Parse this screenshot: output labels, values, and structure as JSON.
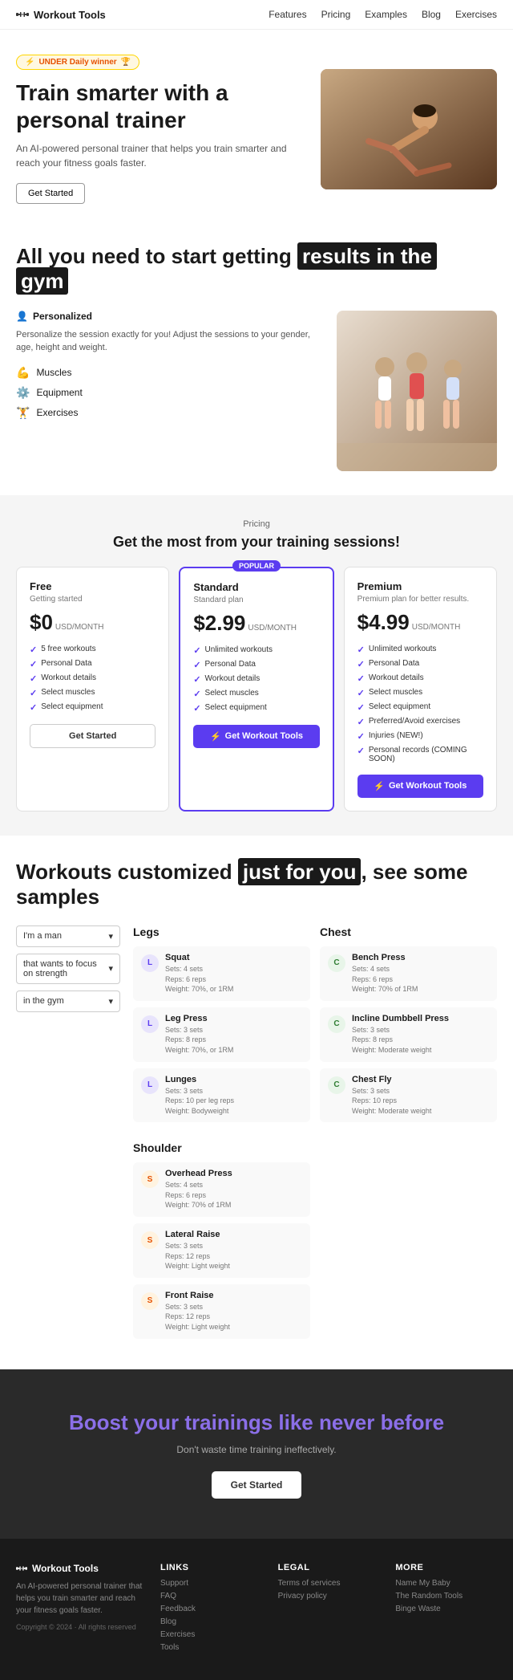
{
  "nav": {
    "logo": "Workout Tools",
    "links": [
      "Features",
      "Pricing",
      "Examples",
      "Blog",
      "Exercises"
    ]
  },
  "hero": {
    "badge": "UNDER Daily winner",
    "title": "Train smarter with a personal trainer",
    "subtitle": "An AI-powered personal trainer that helps you train smarter and reach your fitness goals faster.",
    "cta": "Get Started"
  },
  "features": {
    "title_start": "All you need to start getting",
    "title_highlight": "results in the",
    "title_end": "gym",
    "personalized_label": "Personalized",
    "personalized_desc": "Personalize the session exactly for you! Adjust the sessions to your gender, age, height and weight.",
    "items": [
      {
        "icon": "muscles",
        "label": "Muscles"
      },
      {
        "icon": "equipment",
        "label": "Equipment"
      },
      {
        "icon": "exercises",
        "label": "Exercises"
      }
    ]
  },
  "pricing": {
    "section_label": "Pricing",
    "title": "Get the most from your training sessions!",
    "plans": [
      {
        "tier": "Free",
        "subtitle": "Getting started",
        "price": "$0",
        "period": "USD/MONTH",
        "features": [
          "5 free workouts",
          "Personal Data",
          "Workout details",
          "Select muscles",
          "Select equipment"
        ],
        "cta": "Get Started",
        "popular": false
      },
      {
        "tier": "Standard",
        "subtitle": "Standard plan",
        "price": "$2.99",
        "period": "USD/MONTH",
        "features": [
          "Unlimited workouts",
          "Personal Data",
          "Workout details",
          "Select muscles",
          "Select equipment"
        ],
        "cta": "Get Workout Tools",
        "popular": true,
        "popular_label": "POPULAR"
      },
      {
        "tier": "Premium",
        "subtitle": "Premium plan for better results.",
        "price": "$4.99",
        "period": "USD/MONTH",
        "features": [
          "Unlimited workouts",
          "Personal Data",
          "Workout details",
          "Select muscles",
          "Select equipment",
          "Preferred/Avoid exercises",
          "Injuries (NEW!)",
          "Personal records (COMING SOON)"
        ],
        "cta": "Get Workout Tools",
        "popular": false
      }
    ]
  },
  "workouts": {
    "title_start": "Workouts customized",
    "title_highlight": "just for you",
    "title_end": ", see some samples",
    "selectors": [
      {
        "value": "I'm a man",
        "placeholder": "I'm a man"
      },
      {
        "value": "that wants to focus on strength",
        "placeholder": "that wants to focus on strength"
      },
      {
        "value": "in the gym",
        "placeholder": "in the gym"
      }
    ],
    "columns": [
      {
        "title": "Legs",
        "exercises": [
          {
            "letter": "L",
            "color": "purple",
            "name": "Squat",
            "details": "Sets: 4 sets\nReps: 6 reps\nWeight: 70%, or 1RM"
          },
          {
            "letter": "L",
            "color": "purple",
            "name": "Leg Press",
            "details": "Sets: 3 sets\nReps: 8 reps\nWeight: 70%, or 1RM"
          },
          {
            "letter": "L",
            "color": "purple",
            "name": "Lunges",
            "details": "Sets: 3 sets\nReps: 10 per leg reps\nWeight: Bodyweight"
          }
        ]
      },
      {
        "title": "Chest",
        "exercises": [
          {
            "letter": "C",
            "color": "green",
            "name": "Bench Press",
            "details": "Sets: 4 sets\nReps: 6 reps\nWeight: 70% of 1RM"
          },
          {
            "letter": "C",
            "color": "green",
            "name": "Incline Dumbbell Press",
            "details": "Sets: 3 sets\nReps: 8 reps\nWeight: Moderate weight"
          },
          {
            "letter": "C",
            "color": "green",
            "name": "Chest Fly",
            "details": "Sets: 3 sets\nReps: 10 reps\nWeight: Moderate weight"
          }
        ]
      }
    ],
    "shoulder_title": "Shoulder",
    "shoulder_exercises": [
      {
        "letter": "S",
        "color": "orange",
        "name": "Overhead Press",
        "details": "Sets: 4 sets\nReps: 6 reps\nWeight: 70% of 1RM"
      },
      {
        "letter": "S",
        "color": "orange",
        "name": "Lateral Raise",
        "details": "Sets: 3 sets\nReps: 12 reps\nWeight: Light weight"
      },
      {
        "letter": "S",
        "color": "orange",
        "name": "Front Raise",
        "details": "Sets: 3 sets\nReps: 12 reps\nWeight: Light weight"
      }
    ]
  },
  "cta": {
    "title": "Boost your trainings like never before",
    "subtitle": "Don't waste time training ineffectively.",
    "button": "Get Started"
  },
  "footer": {
    "brand": "Workout Tools",
    "description": "An AI-powered personal trainer that helps you train smarter and reach your fitness goals faster.",
    "copyright": "Copyright © 2024 · All rights reserved",
    "columns": [
      {
        "title": "LINKS",
        "links": [
          "Support",
          "FAQ",
          "Feedback",
          "Blog",
          "Exercises",
          "Tools"
        ]
      },
      {
        "title": "LEGAL",
        "links": [
          "Terms of services",
          "Privacy policy"
        ]
      },
      {
        "title": "MORE",
        "links": [
          "Name My Baby",
          "The Random Tools",
          "Binge Waste"
        ]
      }
    ]
  }
}
